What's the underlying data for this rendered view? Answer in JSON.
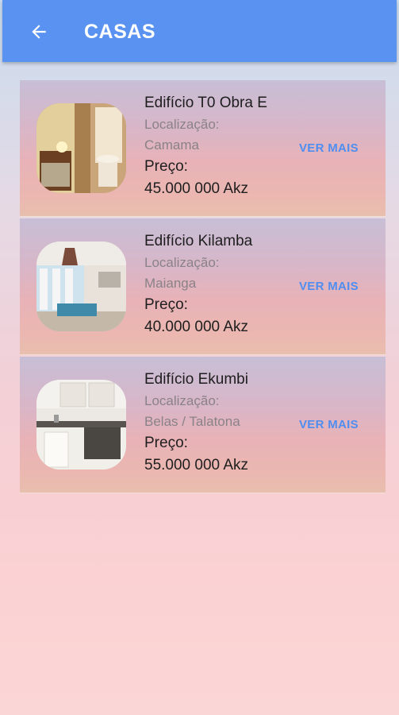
{
  "header": {
    "title": "CASAS",
    "back_icon": "arrow-left-icon",
    "background": "#5a92f2"
  },
  "listings": [
    {
      "name": "Edifício T0 Obra E",
      "location_label": "Localização:",
      "location": "Camama",
      "price_label": "Preço:",
      "price": "45.000 000 Akz",
      "action_label": "VER MAIS"
    },
    {
      "name": "Edifício Kilamba",
      "location_label": "Localização:",
      "location": "Maianga",
      "price_label": "Preço:",
      "price": "40.000 000 Akz",
      "action_label": "VER MAIS"
    },
    {
      "name": "Edifício Ekumbi",
      "location_label": "Localização:",
      "location": "Belas / Talatona",
      "price_label": "Preço:",
      "price": "55.000 000 Akz",
      "action_label": "VER MAIS"
    }
  ],
  "colors": {
    "accent": "#4f8ef0",
    "text_primary": "#1e1e1e",
    "text_secondary": "#8a8288"
  }
}
